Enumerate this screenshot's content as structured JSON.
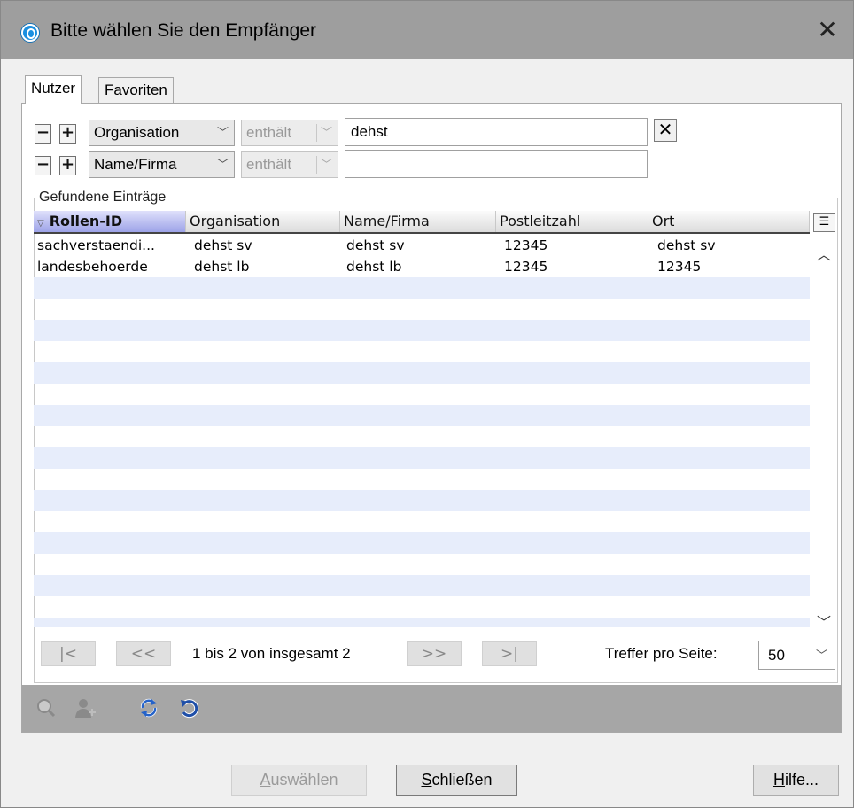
{
  "window": {
    "title": "Bitte wählen Sie den Empfänger",
    "close_glyph": "✕"
  },
  "tabs": [
    {
      "label": "Nutzer",
      "active": true
    },
    {
      "label": "Favoriten",
      "active": false
    }
  ],
  "filters": [
    {
      "remove": "−",
      "add": "+",
      "field": "Organisation",
      "operator": "enthält",
      "value": "dehst",
      "clear": "✕"
    },
    {
      "remove": "−",
      "add": "+",
      "field": "Name/Firma",
      "operator": "enthält",
      "value": ""
    }
  ],
  "results": {
    "title": "Gefundene Einträge",
    "columns": [
      "Rollen-ID",
      "Organisation",
      "Name/Firma",
      "Postleitzahl",
      "Ort"
    ],
    "sort_column": "Rollen-ID",
    "rows": [
      [
        "sachverstaendi...",
        "dehst sv",
        "dehst sv",
        "12345",
        "dehst sv"
      ],
      [
        "landesbehoerde",
        "dehst lb",
        "dehst lb",
        "12345",
        "12345"
      ]
    ]
  },
  "pagination": {
    "first": "|<",
    "prev": "<<",
    "next": ">>",
    "last": ">|",
    "status": "1 bis 2 von insgesamt 2",
    "per_page_label": "Treffer pro Seite:",
    "per_page": "50"
  },
  "toolbar": {
    "icons": [
      "search-user-icon",
      "add-user-icon",
      "refresh-icon",
      "reset-icon"
    ]
  },
  "buttons": {
    "select_accel": "A",
    "select_rest": "uswählen",
    "close_accel": "S",
    "close_rest": "chließen",
    "help_accel": "H",
    "help_rest": "ilfe..."
  },
  "colors": {
    "titlebar": "#9e9e9e",
    "row_alt": "#e7edfb",
    "sorted_header": "#9da3e8",
    "toolbar": "#a6a6a6"
  }
}
